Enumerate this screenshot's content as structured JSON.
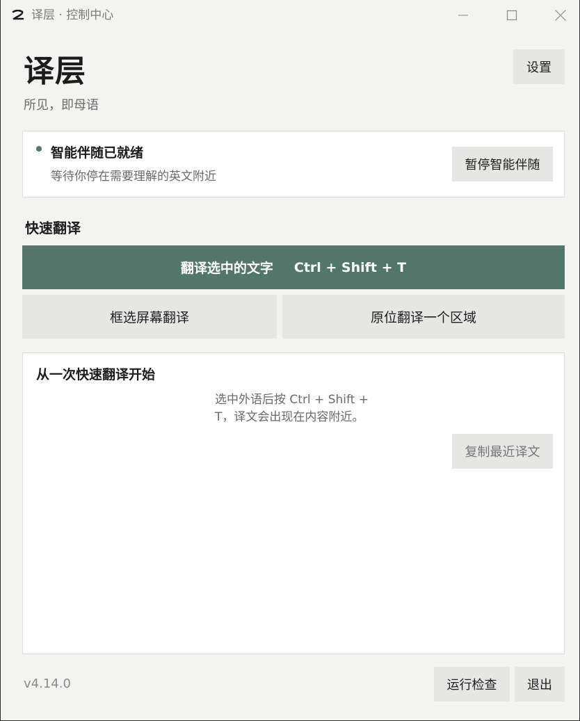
{
  "titlebar": {
    "title": "译层 · 控制中心",
    "logo_icon": "app-logo-icon",
    "minimize_icon": "minimize-icon",
    "maximize_icon": "maximize-icon",
    "close_icon": "close-icon"
  },
  "header": {
    "title": "译层",
    "subtitle": "所见，即母语",
    "settings_label": "设置"
  },
  "status": {
    "title": "智能伴随已就绪",
    "description": "等待你停在需要理解的英文附近",
    "pause_label": "暂停智能伴随",
    "indicator_color": "#52796a"
  },
  "quick_translate": {
    "section_title": "快速翻译",
    "primary_label": "翻译选中的文字",
    "primary_shortcut": "Ctrl + Shift + T",
    "box_select_label": "框选屏幕翻译",
    "in_place_label": "原位翻译一个区域",
    "accent_color": "#52776a"
  },
  "recent": {
    "title": "从一次快速翻译开始",
    "hint": "选中外语后按 Ctrl + Shift + T，译文会出现在内容附近。",
    "copy_label": "复制最近译文"
  },
  "footer": {
    "version": "v4.14.0",
    "check_label": "运行检查",
    "exit_label": "退出"
  }
}
